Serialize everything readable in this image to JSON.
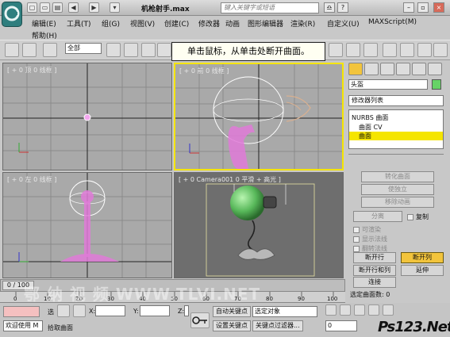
{
  "window": {
    "title": "机枪射手.max",
    "search_placeholder": "键入关键字或短语",
    "quick_access": [
      "▢",
      "▭",
      "▤",
      "◀",
      "▶",
      "▾"
    ],
    "title_buttons": [
      "♎",
      "?",
      "–",
      "▫",
      "×"
    ]
  },
  "menu": {
    "row1": [
      "编辑(E)",
      "工具(T)",
      "组(G)",
      "视图(V)",
      "创建(C)",
      "修改器",
      "动画",
      "图形编辑器",
      "渲染(R)",
      "自定义(U)",
      "MAXScript(M)"
    ],
    "row2": [
      "帮助(H)"
    ]
  },
  "toolbar": {
    "selection_filter": "全部",
    "tooltip": "单击鼠标，从单击处断开曲面。"
  },
  "viewports": {
    "top_label": "[ + 0 顶 0 线框 ]",
    "front_label": "[ + 0 前 0 线框 ]",
    "left_label": "[ + 0 左 0 线框 ]",
    "camera_label": "[ + 0 Camera001 0 平滑 + 高光 ]"
  },
  "panel": {
    "object_name": "头盔",
    "object_color": "#66d366",
    "modifier_list": "修改器列表",
    "stack": [
      "NURBS 曲面",
      "曲面 CV",
      "曲面"
    ],
    "buttons_top": [
      "转化曲面",
      "使独立",
      "移除动画"
    ],
    "separate_label": "分离",
    "copy_label": "复制",
    "checkboxes": [
      "可渲染",
      "显示法线",
      "翻转法线"
    ],
    "break_row_label": "断开行",
    "break_col_label": "断开列",
    "break_both_label": "断开行和列",
    "extend_label": "延伸",
    "join_label": "连接",
    "selected_count": "选定曲面数: 0"
  },
  "timeline": {
    "frame": "0 / 100",
    "ticks": [
      "0",
      "10",
      "20",
      "30",
      "40",
      "50",
      "60",
      "70",
      "80",
      "90",
      "100"
    ]
  },
  "status": {
    "welcome": "欢迎使用 M",
    "prompt": "拾取曲面",
    "sel_label": "选",
    "x_label": "X:",
    "y_label": "Y:",
    "z_label": "Z:",
    "auto_key": "自动关键点",
    "set_key": "设置关键点",
    "selected_object": "选定对象",
    "key_filter": "关键点过滤器...",
    "frame_value": "0"
  },
  "watermark": "鄂 纳 视 频   WWW.TLVI.NET",
  "brand": "Ps123.Net",
  "colors": {
    "accent": "#f2c43c",
    "selection_yellow": "#f5e500",
    "object_green": "#66d366",
    "pink_object": "#e07ad8"
  }
}
